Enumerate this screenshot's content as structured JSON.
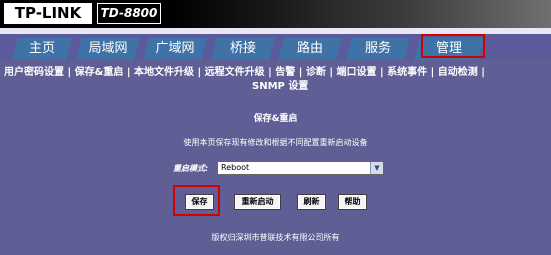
{
  "header": {
    "logo": "TP-LINK",
    "model": "TD-8800"
  },
  "tabs": [
    {
      "label": "主页",
      "active": false
    },
    {
      "label": "局域网",
      "active": false
    },
    {
      "label": "广域网",
      "active": false
    },
    {
      "label": "桥接",
      "active": false
    },
    {
      "label": "路由",
      "active": false
    },
    {
      "label": "服务",
      "active": false
    },
    {
      "label": "管理",
      "active": true
    }
  ],
  "submenu": [
    "用户密码设置",
    "保存&重启",
    "本地文件升级",
    "远程文件升级",
    "告警",
    "诊断",
    "端口设置",
    "系统事件",
    "自动检测",
    "SNMP 设置"
  ],
  "separator": "|",
  "page": {
    "title": "保存&重启",
    "description": "使用本页保存现有修改和根据不同配置重新启动设备",
    "restart_mode_label": "重启模式:",
    "restart_mode_value": "Reboot"
  },
  "buttons": {
    "save": "保存",
    "restart": "重新启动",
    "refresh": "刷新",
    "help": "帮助"
  },
  "footer": "版权归深圳市普联技术有限公司所有",
  "colors": {
    "background": "#5f5f95",
    "tab": "#3f73a8",
    "highlight": "#d40000"
  }
}
